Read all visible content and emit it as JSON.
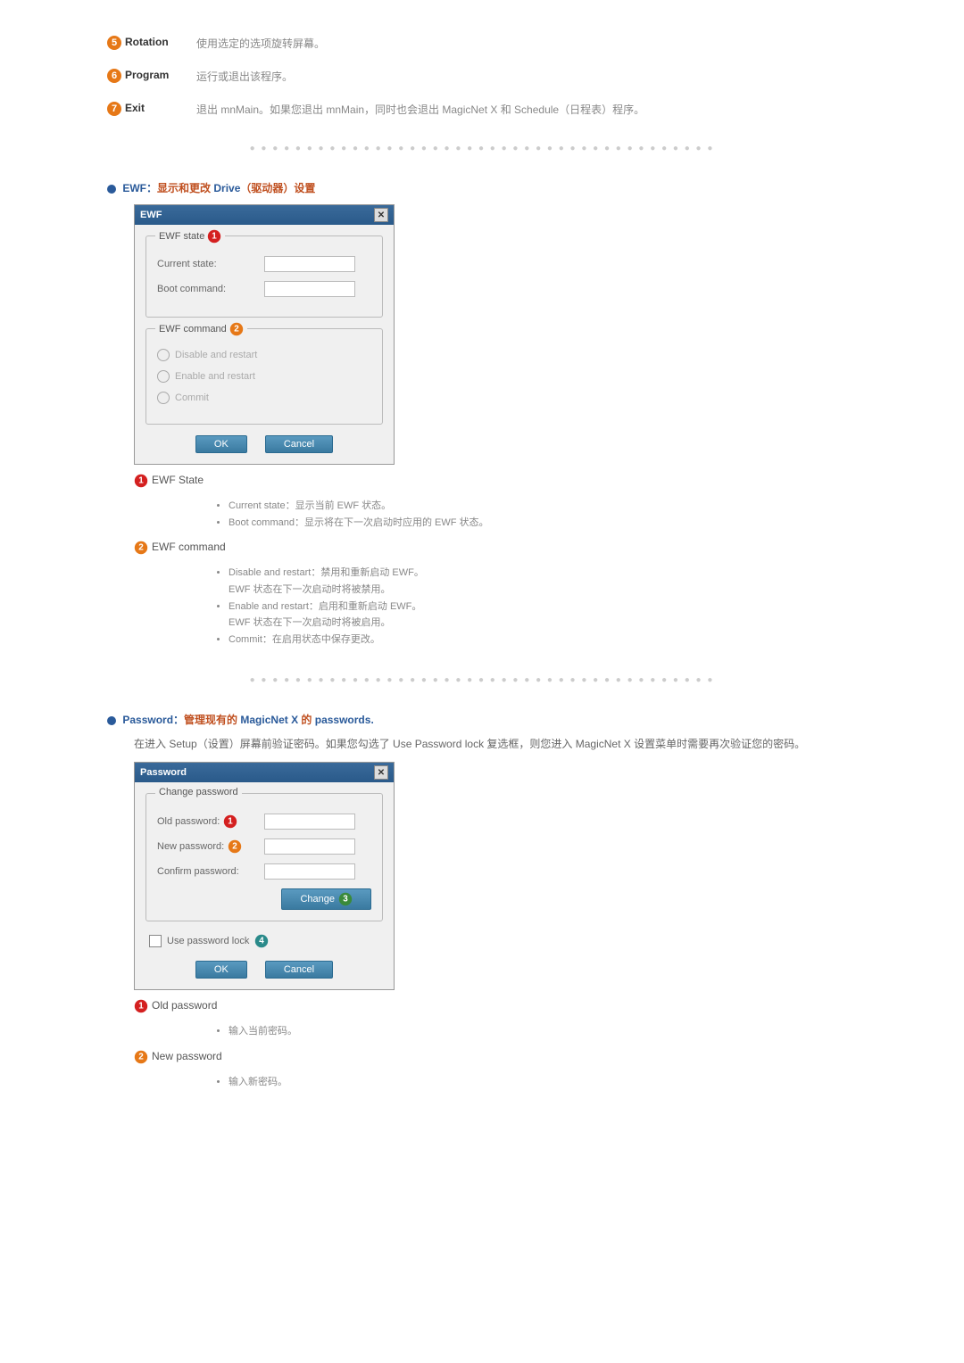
{
  "items": {
    "rotation": {
      "label": "Rotation",
      "desc": "使用选定的选项旋转屏幕。"
    },
    "program": {
      "label": "Program",
      "desc": "运行或退出该程序。"
    },
    "exit": {
      "label": "Exit",
      "desc": "退出 mnMain。如果您退出 mnMain，同时也会退出 MagicNet X 和 Schedule（日程表）程序。"
    }
  },
  "ewf": {
    "heading_prefix": "EWF：",
    "heading_mid": "显示和更改 ",
    "heading_drive": "Drive",
    "heading_suffix": "（驱动器）设置",
    "dialog_title": "EWF",
    "state_legend": "EWF state",
    "current_state_label": "Current state:",
    "boot_command_label": "Boot command:",
    "command_legend": "EWF command",
    "opt_disable": "Disable and restart",
    "opt_enable": "Enable and restart",
    "opt_commit": "Commit",
    "btn_ok": "OK",
    "btn_cancel": "Cancel",
    "explain": {
      "state_title": "EWF State",
      "state_b1_label": "Current state：",
      "state_b1_desc": "显示当前 EWF 状态。",
      "state_b2_label": "Boot command：",
      "state_b2_desc": "显示将在下一次启动时应用的 EWF 状态。",
      "cmd_title": "EWF command",
      "cmd_b1_label": "Disable and restart：",
      "cmd_b1_desc": "禁用和重新启动 EWF。",
      "cmd_b1_sub": "EWF 状态在下一次启动时将被禁用。",
      "cmd_b2_label": "Enable and restart：",
      "cmd_b2_desc": "启用和重新启动 EWF。",
      "cmd_b2_sub": "EWF 状态在下一次启动时将被启用。",
      "cmd_b3_label": "Commit：",
      "cmd_b3_desc": "在启用状态中保存更改。"
    }
  },
  "password": {
    "heading_prefix": "Password：",
    "heading_mid": "管理现有的 ",
    "heading_magicnet": "MagicNet X",
    "heading_mid2": " 的 ",
    "heading_pw": "passwords.",
    "desc": "在进入 Setup（设置）屏幕前验证密码。如果您勾选了 Use Password lock 复选框，则您进入 MagicNet X 设置菜单时需要再次验证您的密码。",
    "dialog_title": "Password",
    "change_legend": "Change password",
    "old_label": "Old password:",
    "new_label": "New password:",
    "confirm_label": "Confirm password:",
    "btn_change": "Change",
    "use_lock_label": "Use password lock",
    "btn_ok": "OK",
    "btn_cancel": "Cancel",
    "explain": {
      "old_title": "Old password",
      "old_desc": "输入当前密码。",
      "new_title": "New password",
      "new_desc": "输入新密码。"
    }
  },
  "badges": {
    "n1": "1",
    "n2": "2",
    "n3": "3",
    "n4": "4",
    "n5": "5",
    "n6": "6",
    "n7": "7"
  }
}
